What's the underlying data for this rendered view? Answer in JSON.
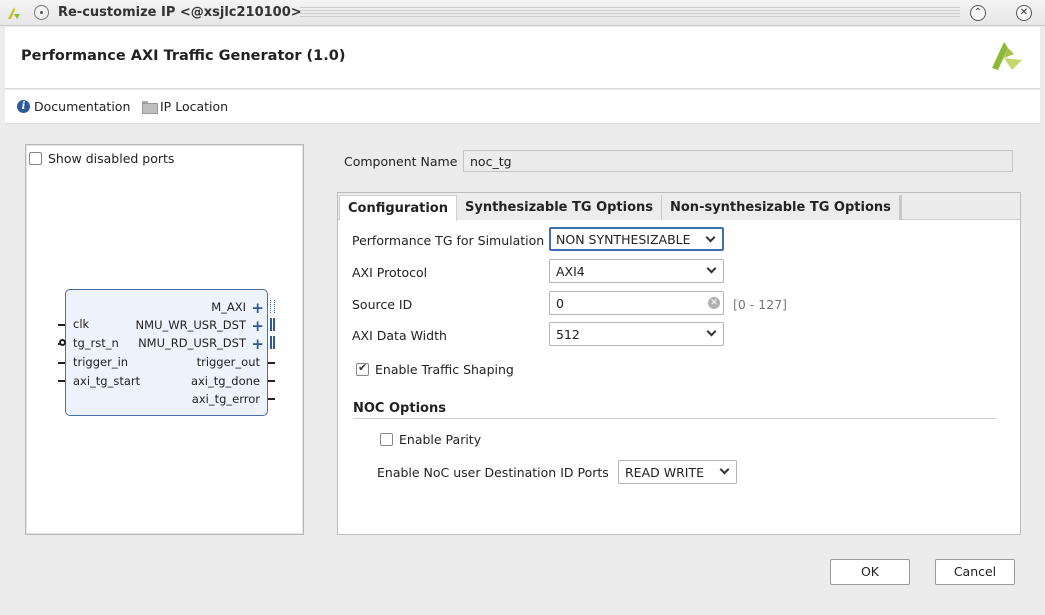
{
  "window": {
    "title": "Re-customize IP <@xsjlc210100>",
    "icons": [
      "app-logo",
      "menu-circle-icon",
      "collapse-icon",
      "close-icon"
    ]
  },
  "header": {
    "title": "Performance AXI Traffic Generator (1.0)"
  },
  "toolbar": {
    "documentation": "Documentation",
    "ip_location": "IP Location"
  },
  "left_panel": {
    "show_disabled_ports": "Show disabled ports",
    "show_disabled_checked": false,
    "block": {
      "left_ports": [
        "clk",
        "tg_rst_n",
        "trigger_in",
        "axi_tg_start"
      ],
      "right_ports": [
        "M_AXI",
        "NMU_WR_USR_DST",
        "NMU_RD_USR_DST",
        "trigger_out",
        "axi_tg_done",
        "axi_tg_error"
      ]
    }
  },
  "component": {
    "label": "Component Name",
    "value": "noc_tg"
  },
  "tabs": [
    {
      "label": "Configuration",
      "active": true
    },
    {
      "label": "Synthesizable TG Options",
      "active": false
    },
    {
      "label": "Non-synthesizable TG Options",
      "active": false
    }
  ],
  "config": {
    "perf_tg_sim_label": "Performance TG for Simulation",
    "perf_tg_sim_value": "NON SYNTHESIZABLE",
    "axi_protocol_label": "AXI Protocol",
    "axi_protocol_value": "AXI4",
    "source_id_label": "Source ID",
    "source_id_value": "0",
    "source_id_range": "[0 - 127]",
    "axi_data_width_label": "AXI Data Width",
    "axi_data_width_value": "512",
    "enable_traffic_shaping": "Enable Traffic Shaping",
    "enable_traffic_shaping_checked": true,
    "noc_options_title": "NOC Options",
    "enable_parity": "Enable Parity",
    "enable_parity_checked": false,
    "noc_dest_id_label": "Enable NoC user Destination ID Ports",
    "noc_dest_id_value": "READ WRITE"
  },
  "buttons": {
    "ok": "OK",
    "cancel": "Cancel"
  },
  "colors": {
    "accent": "#3d6fb3",
    "block_fill": "#eef3fb",
    "brand_green": "#8fb838"
  }
}
